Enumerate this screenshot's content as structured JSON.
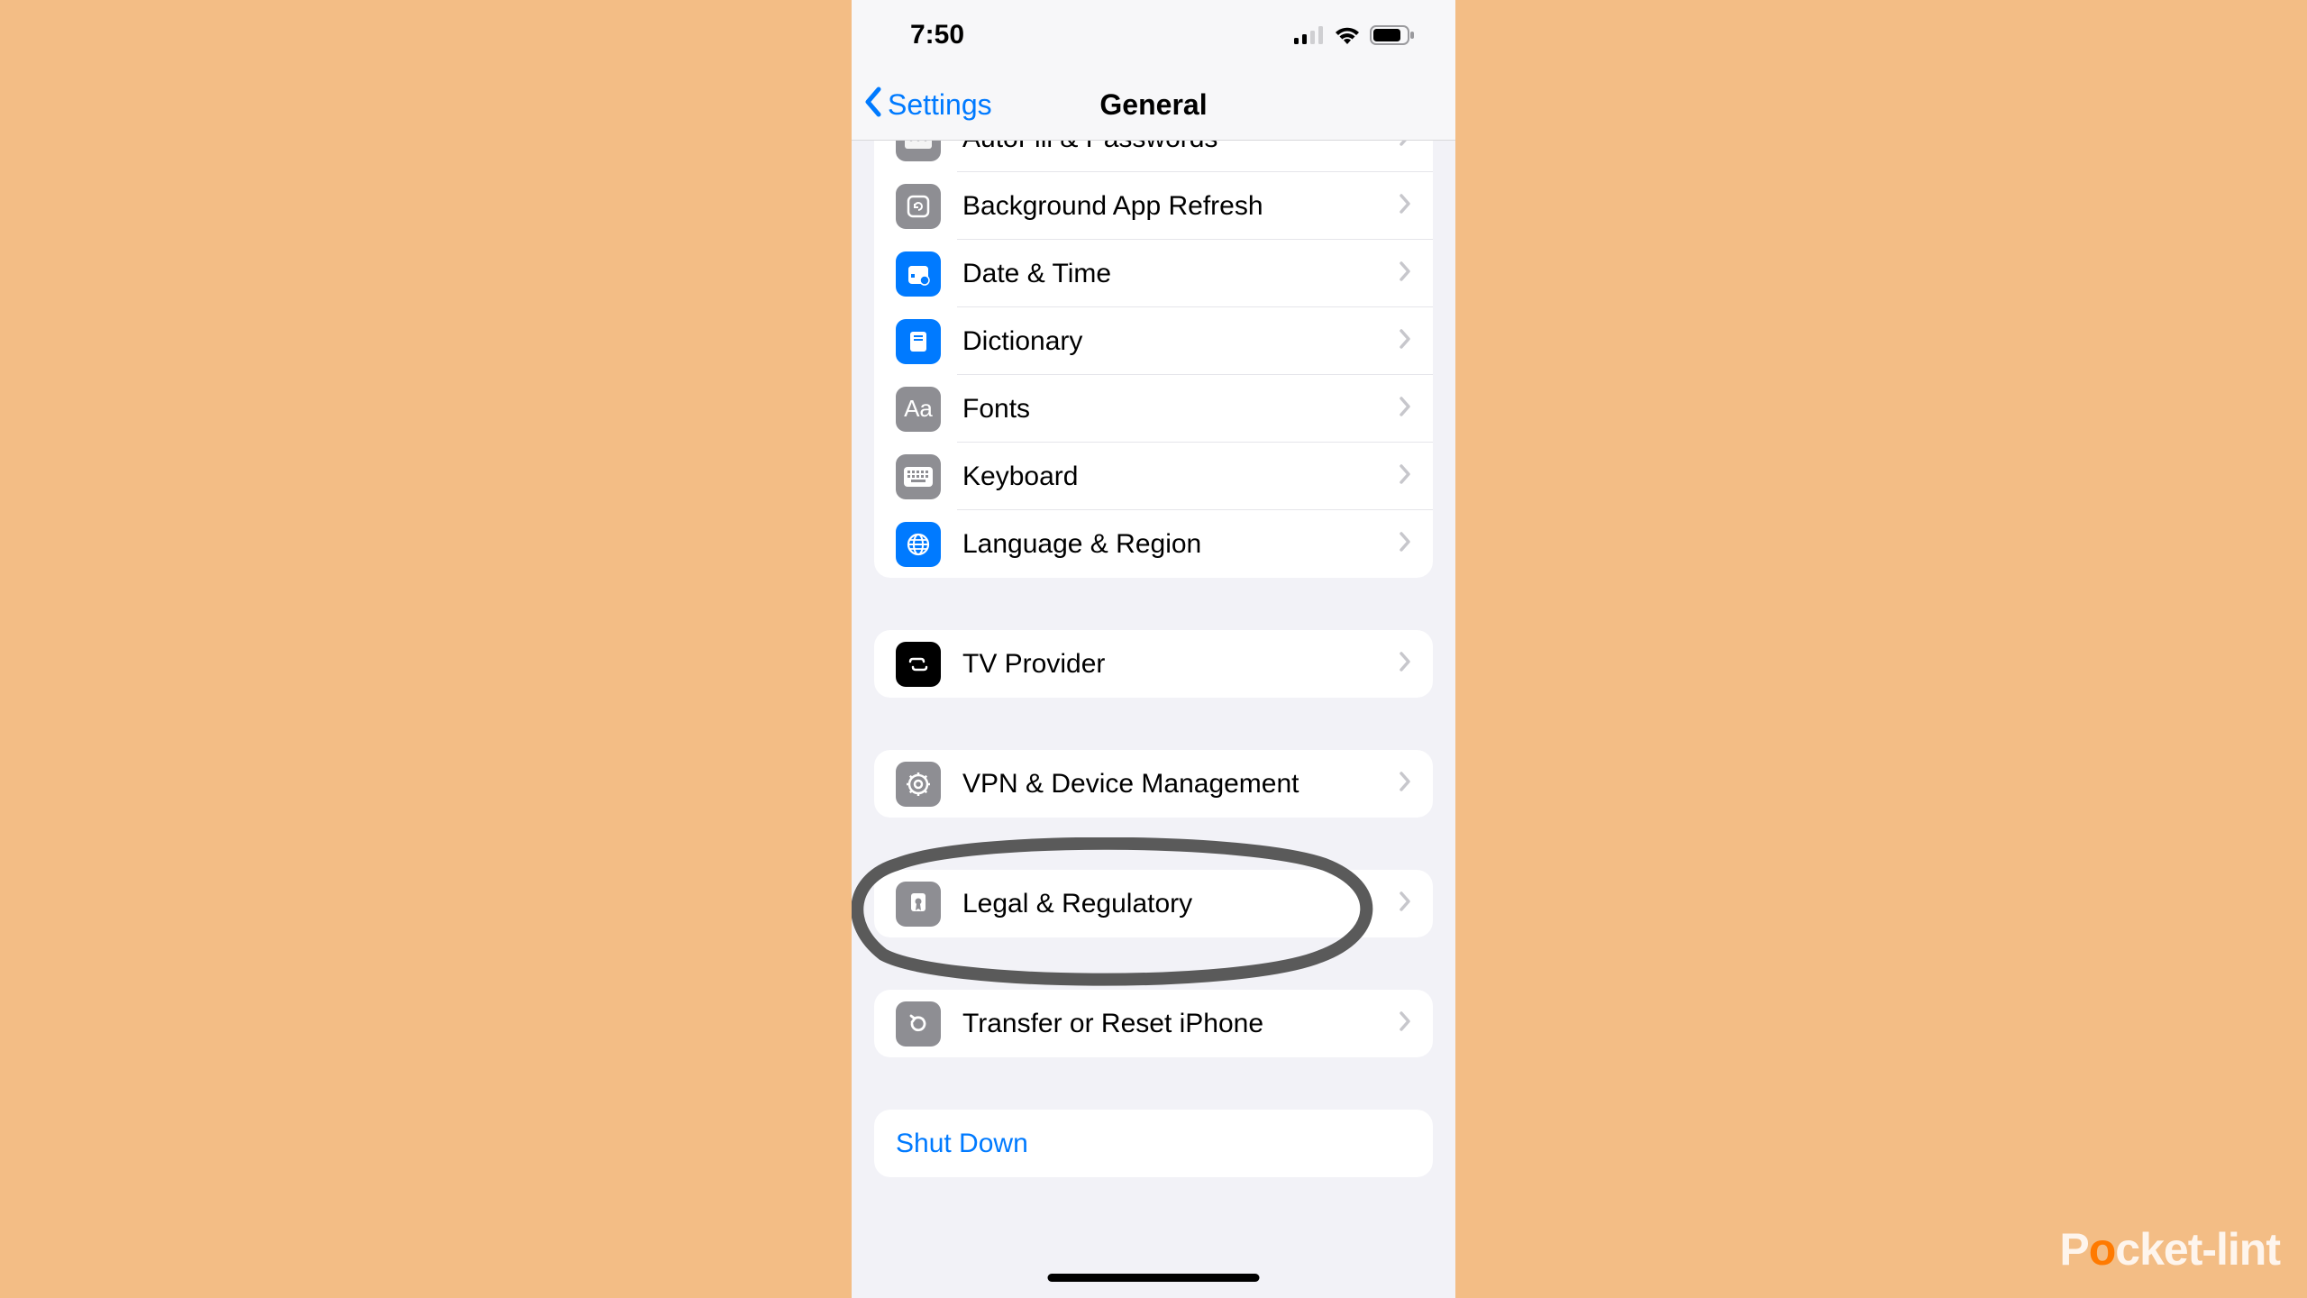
{
  "status": {
    "time": "7:50"
  },
  "nav": {
    "back_label": "Settings",
    "title": "General"
  },
  "sections": [
    {
      "rows": [
        {
          "id": "autofill",
          "label": "AutoFill & Passwords"
        },
        {
          "id": "bgrefresh",
          "label": "Background App Refresh"
        },
        {
          "id": "datetime",
          "label": "Date & Time"
        },
        {
          "id": "dictionary",
          "label": "Dictionary"
        },
        {
          "id": "fonts",
          "label": "Fonts"
        },
        {
          "id": "keyboard",
          "label": "Keyboard"
        },
        {
          "id": "lang",
          "label": "Language & Region"
        }
      ]
    },
    {
      "rows": [
        {
          "id": "tv",
          "label": "TV Provider"
        }
      ]
    },
    {
      "rows": [
        {
          "id": "vpn",
          "label": "VPN & Device Management"
        }
      ]
    },
    {
      "rows": [
        {
          "id": "legal",
          "label": "Legal & Regulatory"
        }
      ]
    },
    {
      "rows": [
        {
          "id": "transfer",
          "label": "Transfer or Reset iPhone"
        }
      ]
    },
    {
      "rows": [
        {
          "id": "shutdown",
          "label": "Shut Down"
        }
      ]
    }
  ],
  "watermark": {
    "prefix": "P",
    "accent": "o",
    "suffix": "cket-lint"
  }
}
